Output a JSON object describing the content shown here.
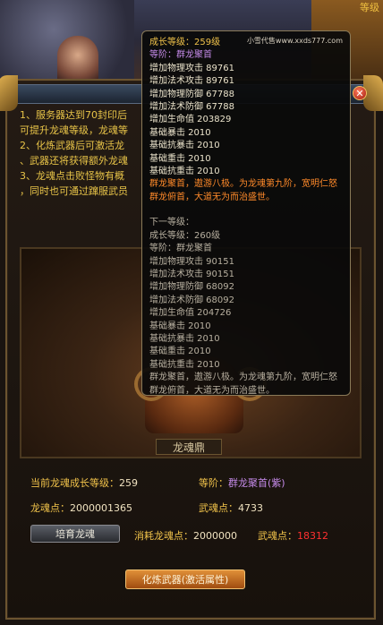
{
  "top_right_text": "等级",
  "tooltip": {
    "watermark": "小雪代售www.xxds777.com",
    "current": [
      {
        "text": "成长等级：259级",
        "tone": "yellow"
      },
      {
        "text": "等阶：群龙聚首",
        "tone": "purple"
      },
      {
        "text": "增加物理攻击  89761",
        "tone": "white"
      },
      {
        "text": "增加法术攻击  89761",
        "tone": "white"
      },
      {
        "text": "增加物理防御  67788",
        "tone": "white"
      },
      {
        "text": "增加法术防御  67788",
        "tone": "white"
      },
      {
        "text": "增加生命值  203829",
        "tone": "white"
      },
      {
        "text": "基础暴击  2010",
        "tone": "white"
      },
      {
        "text": "基础抗暴击  2010",
        "tone": "white"
      },
      {
        "text": "基础重击  2010",
        "tone": "white"
      },
      {
        "text": "基础抗重击  2010",
        "tone": "white"
      }
    ],
    "current_desc": "群龙聚首，遨游八极。为龙魂第九阶，宽明仁怒群龙俯首，大道无为而治盛世。",
    "next_header": "下一等级：",
    "next": [
      {
        "text": "成长等级：260级"
      },
      {
        "text": "等阶：群龙聚首"
      },
      {
        "text": "增加物理攻击  90151"
      },
      {
        "text": "增加法术攻击  90151"
      },
      {
        "text": "增加物理防御  68092"
      },
      {
        "text": "增加法术防御  68092"
      },
      {
        "text": "增加生命值  204726"
      },
      {
        "text": "基础暴击  2010"
      },
      {
        "text": "基础抗暴击  2010"
      },
      {
        "text": "基础重击  2010"
      },
      {
        "text": "基础抗重击  2010"
      }
    ],
    "next_desc": "群龙聚首，遨游八极。为龙魂第九阶，宽明仁怒群龙俯首，大道无为而治盛世。"
  },
  "tips": [
    "1、服务器达到70封印后",
    "可提升龙魂等级，龙魂等",
    "2、化炼武器后可激活龙",
    "、武器还将获得额外龙魂",
    "3、龙魂点击败怪物有概",
    "，同时也可通过蹿服武员"
  ],
  "art_label": "龙魂鼎",
  "stats": {
    "growth_level_label": "当前龙魂成长等级：",
    "growth_level_value": "259",
    "rank_label": "等阶：",
    "rank_value": "群龙聚首(紫)",
    "dragon_points_label": "龙魂点：",
    "dragon_points_value": "2000001365",
    "weapon_points_label": "武魂点：",
    "weapon_points_value": "4733",
    "consume_label": "消耗龙魂点：",
    "consume_value": "2000000",
    "weapon_points2_label": "武魂点：",
    "weapon_points2_value": "18312"
  },
  "buttons": {
    "train": "培育龙魂",
    "refine": "化炼武器(激活属性)",
    "close": "✕"
  }
}
